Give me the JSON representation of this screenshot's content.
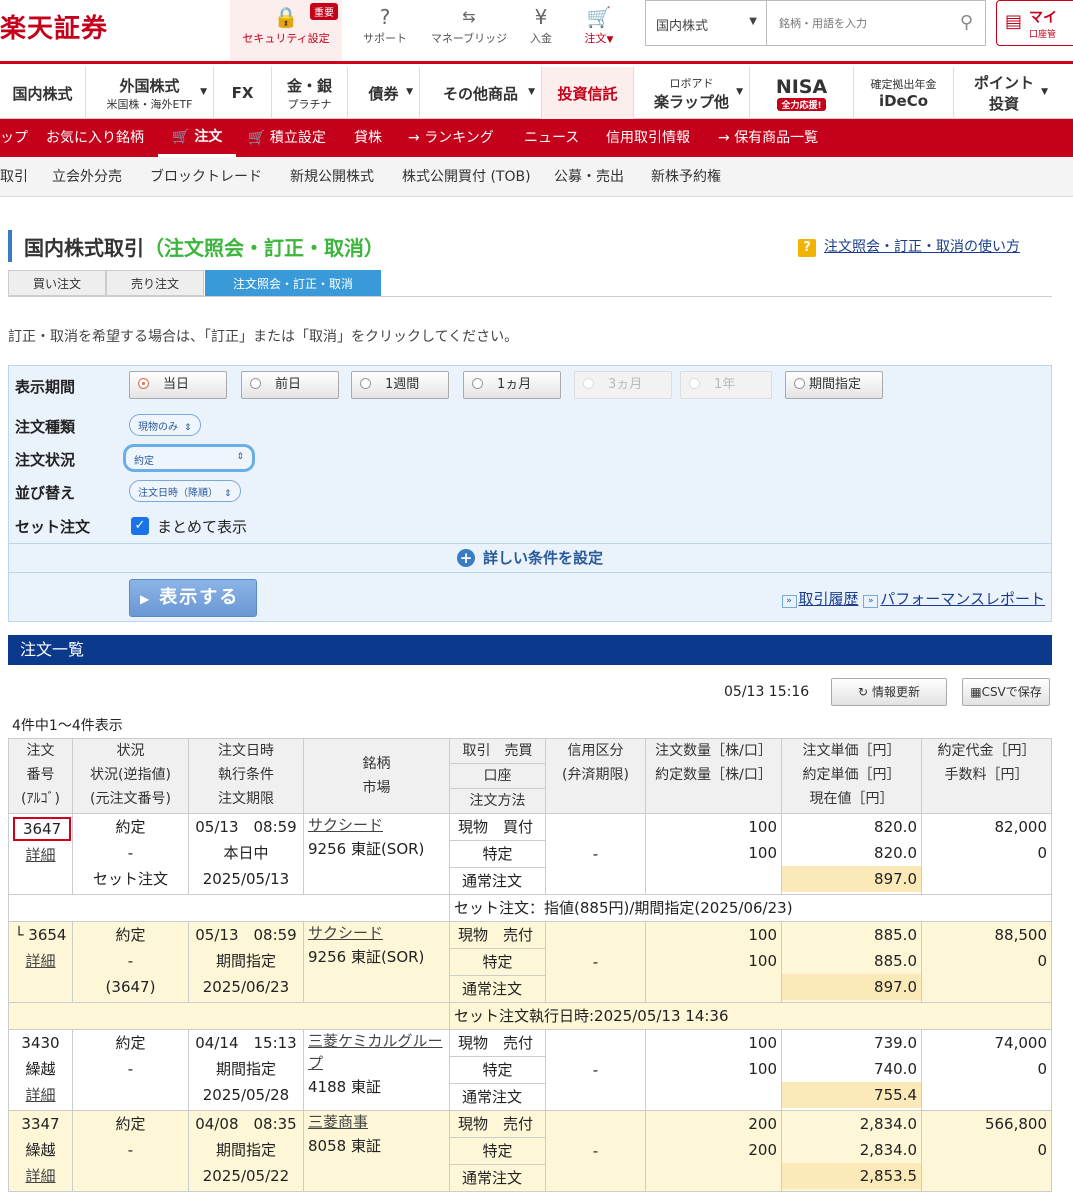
{
  "header": {
    "logo": "楽天証券",
    "security": "セキュリティ設定",
    "badge": "重要",
    "support": "サポート",
    "bridge": "マネーブリッジ",
    "deposit": "入金",
    "order": "注文",
    "order_caret": "▼",
    "market_select": "国内株式",
    "search_placeholder": "銘柄・用語を入力",
    "mypage_l1": "マイ",
    "mypage_l2": "口座管"
  },
  "mainnav": {
    "items": [
      {
        "label": "国内株式",
        "sub": ""
      },
      {
        "label": "外国株式",
        "sub": "米国株・海外ETF"
      },
      {
        "label": "FX",
        "sub": ""
      },
      {
        "label": "金・銀",
        "sub": "プラチナ"
      },
      {
        "label": "債券",
        "sub": ""
      },
      {
        "label": "その他商品",
        "sub": ""
      },
      {
        "label": "投資信託",
        "sub": ""
      },
      {
        "label": "ロボアド",
        "sub": "楽ラップ他"
      },
      {
        "label": "NISA",
        "sub": "全力応援!"
      },
      {
        "label": "確定拠出年金",
        "sub": "iDeCo"
      },
      {
        "label": "ポイント",
        "sub": "投資"
      }
    ]
  },
  "rednav": [
    "ップ",
    "お気に入り銘柄",
    "注文",
    "積立設定",
    "貸株",
    "ランキング",
    "ニュース",
    "信用取引情報",
    "保有商品一覧"
  ],
  "graynav": [
    "取引",
    "立会外分売",
    "ブロックトレード",
    "新規公開株式",
    "株式公開買付 (TOB)",
    "公募・売出",
    "新株予約権"
  ],
  "page": {
    "title_main": "国内株式取引",
    "title_sub": "（注文照会・訂正・取消）",
    "help": "注文照会・訂正・取消の使い方",
    "help_icon": "?",
    "tabs": [
      "買い注文",
      "売り注文",
      "注文照会・訂正・取消"
    ],
    "instruction": "訂正・取消を希望する場合は、「訂正」または「取消」をクリックしてください。"
  },
  "filter": {
    "period_label": "表示期間",
    "periods": [
      "当日",
      "前日",
      "1週間",
      "1ヵ月",
      "3ヵ月",
      "1年",
      "期間指定"
    ],
    "type_label": "注文種類",
    "type_value": "現物のみ",
    "status_label": "注文状況",
    "status_value": "約定",
    "sort_label": "並び替え",
    "sort_value": "注文日時（降順）",
    "set_label": "セット注文",
    "set_checkbox": "まとめて表示",
    "detail": "詳しい条件を設定",
    "show_button": "表示する",
    "link_history": "取引履歴",
    "link_perf": "パフォーマンスレポート"
  },
  "list": {
    "title": "注文一覧",
    "timestamp": "05/13 15:16",
    "refresh": "情報更新",
    "csv": "CSVで保存",
    "count": "4件中1〜4件表示"
  },
  "table": {
    "headers": {
      "no": [
        "注文",
        "番号",
        "(ｱﾙｺﾞ)"
      ],
      "status": [
        "状況",
        "状況(逆指値)",
        "(元注文番号)"
      ],
      "date": [
        "注文日時",
        "執行条件",
        "注文期限"
      ],
      "name": [
        "銘柄",
        "市場"
      ],
      "trade": [
        "取引　売買",
        "口座",
        "注文方法"
      ],
      "credit": [
        "信用区分",
        "(弁済期限)"
      ],
      "qty": [
        "注文数量［株/口］",
        "約定数量［株/口］"
      ],
      "price": [
        "注文単価［円］",
        "約定単価［円］",
        "現在値［円］"
      ],
      "amount": [
        "約定代金［円］",
        "手数料［円］"
      ]
    },
    "rows": [
      {
        "no": "3647",
        "no2": "",
        "detail": "詳細",
        "status": "約定",
        "status2": "-",
        "status3": "セット注文",
        "date": "05/13　08:59",
        "cond": "本日中",
        "limit": "2025/05/13",
        "name": "サクシード",
        "market": "9256 東証(SOR)",
        "trade": "現物　買付",
        "account": "特定",
        "method": "通常注文",
        "credit": "-",
        "qty": "100",
        "qty2": "100",
        "price": "820.0",
        "price2": "820.0",
        "price3": "897.0",
        "amount": "82,000",
        "fee": "0",
        "note": "セット注文：指値(885円)/期間指定(2025/06/23)"
      },
      {
        "no": "└ 3654",
        "no2": "",
        "detail": "詳細",
        "status": "約定",
        "status2": "-",
        "status3": "(3647)",
        "date": "05/13　08:59",
        "cond": "期間指定",
        "limit": "2025/06/23",
        "name": "サクシード",
        "market": "9256 東証(SOR)",
        "trade": "現物　売付",
        "account": "特定",
        "method": "通常注文",
        "credit": "-",
        "qty": "100",
        "qty2": "100",
        "price": "885.0",
        "price2": "885.0",
        "price3": "897.0",
        "amount": "88,500",
        "fee": "0",
        "note": "セット注文執行日時:2025/05/13 14:36"
      },
      {
        "no": "3430",
        "no2": "繰越",
        "detail": "詳細",
        "status": "約定",
        "status2": "-",
        "status3": "",
        "date": "04/14　15:13",
        "cond": "期間指定",
        "limit": "2025/05/28",
        "name": "三菱ケミカルグループ",
        "market": "4188 東証",
        "trade": "現物　売付",
        "account": "特定",
        "method": "通常注文",
        "credit": "-",
        "qty": "100",
        "qty2": "100",
        "price": "739.0",
        "price2": "740.0",
        "price3": "755.4",
        "amount": "74,000",
        "fee": "0",
        "note": ""
      },
      {
        "no": "3347",
        "no2": "繰越",
        "detail": "詳細",
        "status": "約定",
        "status2": "-",
        "status3": "",
        "date": "04/08　08:35",
        "cond": "期間指定",
        "limit": "2025/05/22",
        "name": "三菱商事",
        "market": "8058 東証",
        "trade": "現物　売付",
        "account": "特定",
        "method": "通常注文",
        "credit": "-",
        "qty": "200",
        "qty2": "200",
        "price": "2,834.0",
        "price2": "2,834.0",
        "price3": "2,853.5",
        "amount": "566,800",
        "fee": "0",
        "note": ""
      }
    ]
  },
  "colors": {
    "brand": "#c4001a",
    "nav_blue": "#0b3a8c",
    "tab_blue": "#3a9ad9",
    "highlight": "#fbe9b8",
    "row_yellow": "#fdf7d8"
  }
}
